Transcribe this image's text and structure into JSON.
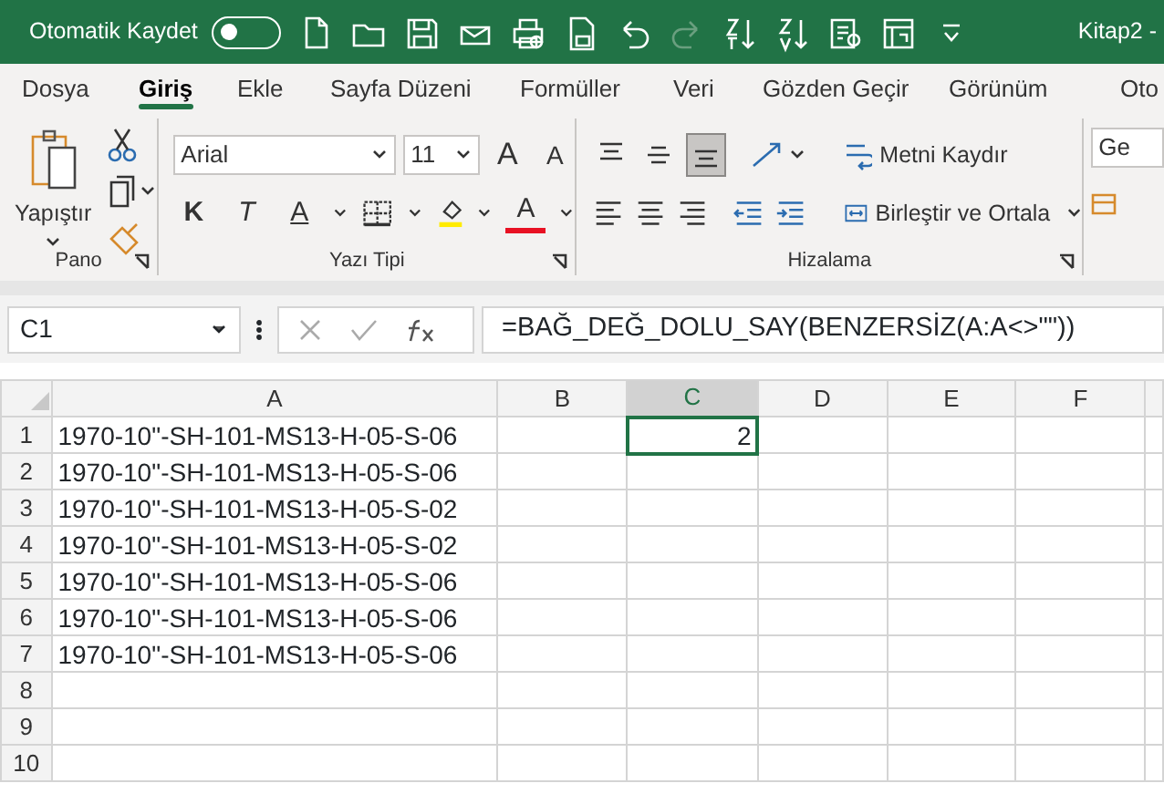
{
  "title_bar": {
    "autosave_label": "Otomatik Kaydet",
    "autosave_on": false,
    "document_title": "Kitap2 -"
  },
  "tabs": [
    {
      "label": "Dosya",
      "selected": false
    },
    {
      "label": "Giriş",
      "selected": true
    },
    {
      "label": "Ekle",
      "selected": false
    },
    {
      "label": "Sayfa Düzeni",
      "selected": false
    },
    {
      "label": "Formüller",
      "selected": false
    },
    {
      "label": "Veri",
      "selected": false
    },
    {
      "label": "Gözden Geçir",
      "selected": false
    },
    {
      "label": "Görünüm",
      "selected": false
    },
    {
      "label": "Oto",
      "selected": false
    }
  ],
  "ribbon": {
    "clipboard": {
      "paste_label": "Yapıştır",
      "group_label": "Pano"
    },
    "font": {
      "font_name": "Arial",
      "font_size": "11",
      "grow_glyph": "A",
      "shrink_glyph": "A",
      "bold_glyph": "K",
      "italic_glyph": "T",
      "underline_glyph": "A",
      "font_color_glyph": "A",
      "group_label": "Yazı Tipi"
    },
    "alignment": {
      "vertical": [
        {
          "kind": "top",
          "selected": false
        },
        {
          "kind": "middle",
          "selected": false
        },
        {
          "kind": "bottom",
          "selected": true
        }
      ],
      "wrap_label": "Metni Kaydır",
      "merge_label": "Birleştir ve Ortala",
      "group_label": "Hizalama"
    },
    "number": {
      "format": "Ge"
    }
  },
  "formula_bar": {
    "name_box": "C1",
    "formula": "=BAĞ_DEĞ_DOLU_SAY(BENZERSİZ(A:A<>\"\"))"
  },
  "sheet": {
    "columns": [
      {
        "label": "A",
        "selected": false
      },
      {
        "label": "B",
        "selected": false
      },
      {
        "label": "C",
        "selected": true
      },
      {
        "label": "D",
        "selected": false
      },
      {
        "label": "E",
        "selected": false
      },
      {
        "label": "F",
        "selected": false
      }
    ],
    "rows": [
      {
        "label": "1",
        "cells": [
          "1970-10\"-SH-101-MS13-H-05-S-06",
          "",
          "2",
          "",
          "",
          ""
        ],
        "selected": [
          false,
          false,
          true,
          false,
          false,
          false
        ]
      },
      {
        "label": "2",
        "cells": [
          "1970-10\"-SH-101-MS13-H-05-S-06",
          "",
          "",
          "",
          "",
          ""
        ]
      },
      {
        "label": "3",
        "cells": [
          "1970-10\"-SH-101-MS13-H-05-S-02",
          "",
          "",
          "",
          "",
          ""
        ]
      },
      {
        "label": "4",
        "cells": [
          "1970-10\"-SH-101-MS13-H-05-S-02",
          "",
          "",
          "",
          "",
          ""
        ]
      },
      {
        "label": "5",
        "cells": [
          "1970-10\"-SH-101-MS13-H-05-S-06",
          "",
          "",
          "",
          "",
          ""
        ]
      },
      {
        "label": "6",
        "cells": [
          "1970-10\"-SH-101-MS13-H-05-S-06",
          "",
          "",
          "",
          "",
          ""
        ]
      },
      {
        "label": "7",
        "cells": [
          "1970-10\"-SH-101-MS13-H-05-S-06",
          "",
          "",
          "",
          "",
          ""
        ]
      },
      {
        "label": "8",
        "cells": [
          "",
          "",
          "",
          "",
          "",
          ""
        ]
      },
      {
        "label": "9",
        "cells": [
          "",
          "",
          "",
          "",
          "",
          ""
        ]
      },
      {
        "label": "10",
        "cells": [
          "",
          "",
          "",
          "",
          "",
          ""
        ]
      }
    ]
  }
}
